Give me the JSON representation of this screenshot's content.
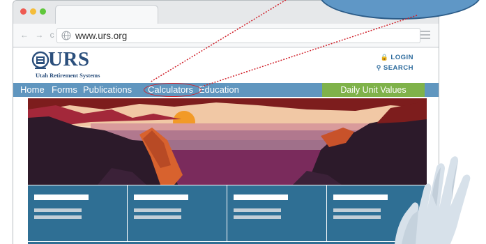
{
  "browser": {
    "url": "www.urs.org",
    "nav_buttons": "← → c"
  },
  "site": {
    "logo": {
      "name": "URS",
      "subtitle": "Utah Retirement Systems"
    },
    "header_links": {
      "login": "LOGIN",
      "search": "SEARCH"
    },
    "nav": {
      "items": [
        {
          "label": "Home"
        },
        {
          "label": "Forms"
        },
        {
          "label": "Publications"
        },
        {
          "label": "Calculators",
          "highlighted": true
        },
        {
          "label": "Education"
        }
      ],
      "cta": "Daily Unit Values"
    }
  },
  "colors": {
    "nav_bar": "#6096bf",
    "cta": "#7fb24a",
    "tiles": "#2f6f94",
    "brand": "#2b4f7c",
    "highlight_ring": "#d0202a",
    "callout": "#5f97c6"
  },
  "icons": {
    "lock": "lock-icon",
    "search": "magnifier-icon",
    "globe": "globe-icon",
    "menu": "hamburger-menu-icon"
  }
}
